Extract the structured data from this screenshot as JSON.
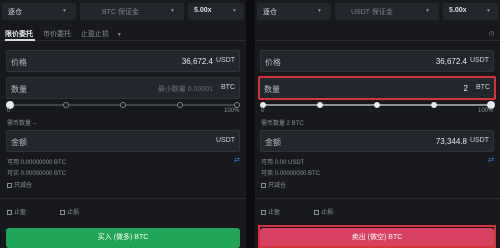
{
  "left": {
    "margin_mode": "逐仓",
    "margin_coin": "BTC 保证金",
    "leverage": "5.00x",
    "tabs": [
      "限价委托",
      "市价委托",
      "止盈止损"
    ],
    "price_label": "价格",
    "price_value": "36,672.4",
    "price_unit": "USDT",
    "qty_label": "数量",
    "qty_placeholder": "最小数量 0.00001",
    "qty_unit": "BTC",
    "pct_start": "0",
    "pct_end": "100%",
    "deposit_note": "需币数量 --",
    "amount_label": "金额",
    "amount_unit": "USDT",
    "available": "可用 0.00000000 BTC",
    "openable": "可买 0.00000000 BTC",
    "reduce_only": "只减仓",
    "take_profit": "止盈",
    "stop_loss": "止损",
    "buy_button": "买入 (做多) BTC"
  },
  "right": {
    "margin_mode": "逐仓",
    "margin_coin": "USDT 保证金",
    "leverage": "5.00x",
    "price_label": "价格",
    "price_value": "36,672.4",
    "price_unit": "USDT",
    "qty_label": "数量",
    "qty_value": "2",
    "qty_unit": "BTC",
    "pct_start": "0",
    "pct_end": "100%",
    "deposit_note": "需币数量 2 BTC",
    "amount_label": "金额",
    "amount_value": "73,344.8",
    "amount_unit": "USDT",
    "available": "可用 0.00 USDT",
    "openable": "可卖 0.00000000 BTC",
    "reduce_only": "只减仓",
    "take_profit": "止盈",
    "stop_loss": "止损",
    "sell_button": "卖出 (做空) BTC"
  },
  "colors": {
    "buy": "#21a558",
    "sell": "#d84160",
    "highlight": "#d1343b"
  }
}
